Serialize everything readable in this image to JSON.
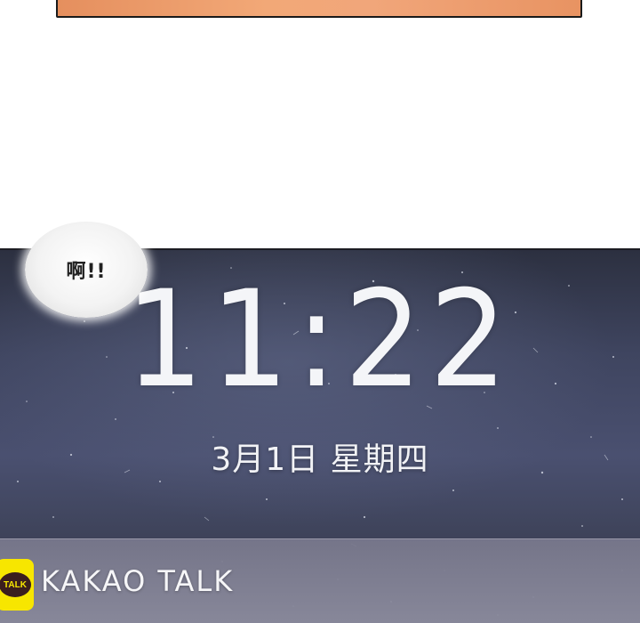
{
  "bubble": {
    "text": "啊!!"
  },
  "lockscreen": {
    "time": "11:22",
    "date": "3月1日 星期四"
  },
  "notification": {
    "app_name": "KAKAO TALK",
    "app_icon_label": "TALK",
    "icon": "kakaotalk-icon"
  },
  "colors": {
    "kakao_yellow": "#f7e600",
    "kakao_brown": "#3b1e1e",
    "top_panel": "#f0a274"
  }
}
